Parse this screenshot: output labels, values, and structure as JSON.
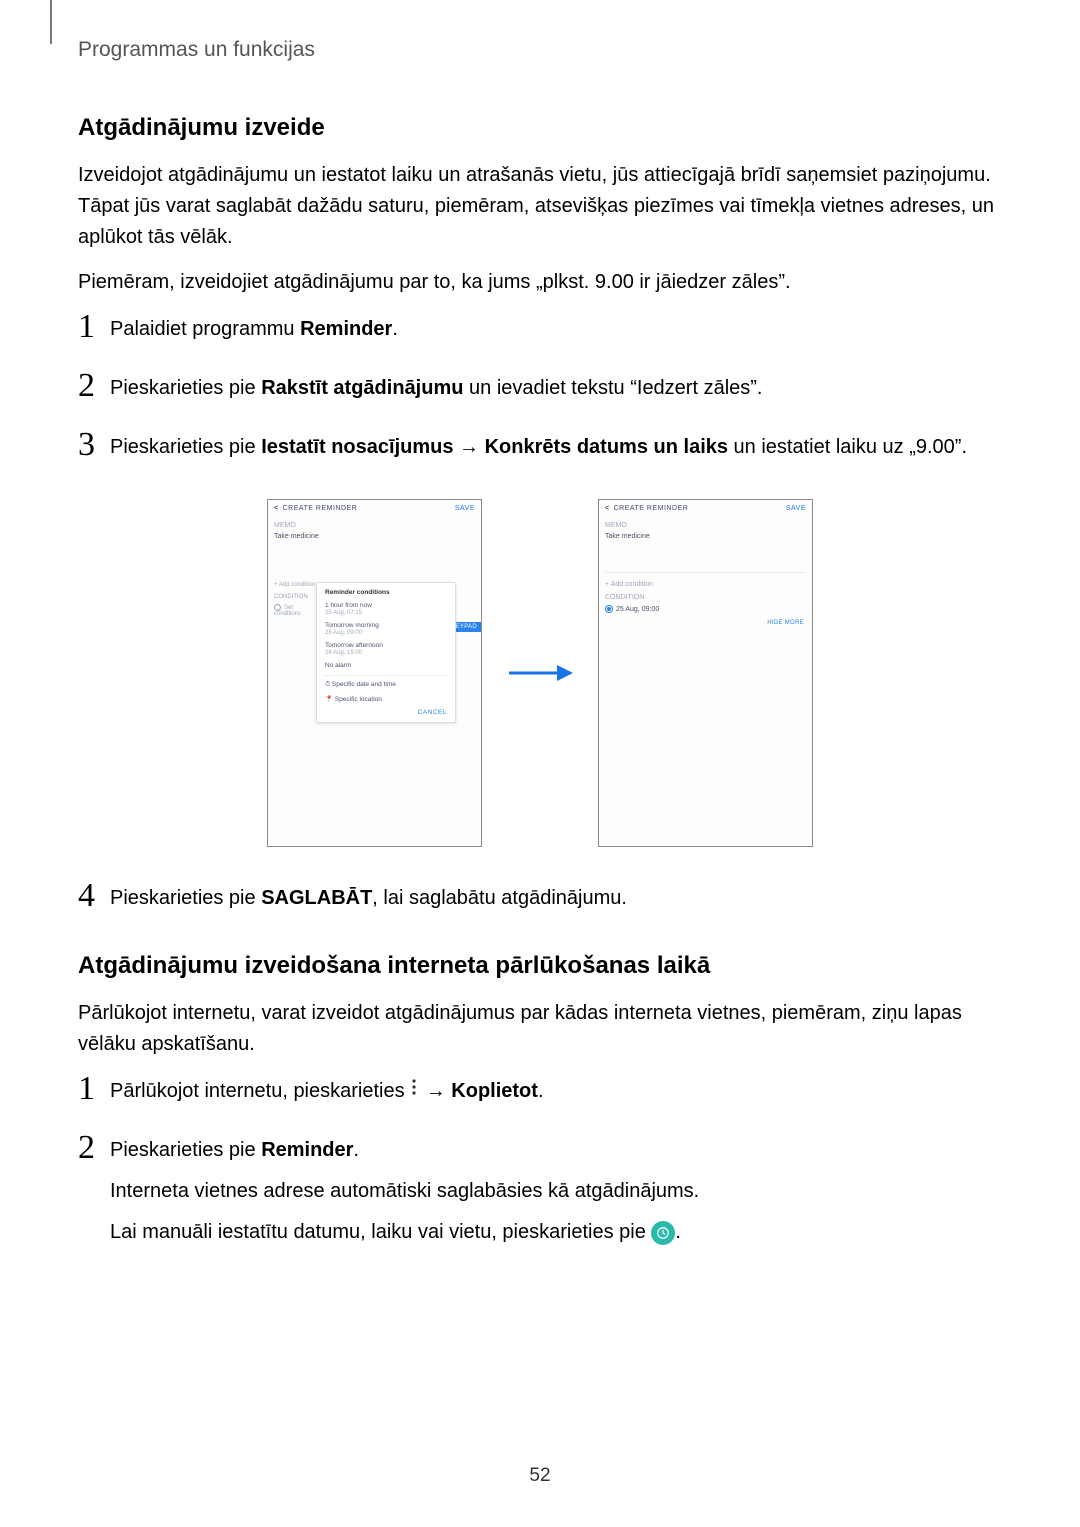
{
  "page": {
    "header": "Programmas un funkcijas",
    "number": "52"
  },
  "section1": {
    "title": "Atgādinājumu izveide",
    "p1": "Izveidojot atgādinājumu un iestatot laiku un atrašanās vietu, jūs attiecīgajā brīdī saņemsiet paziņojumu. Tāpat jūs varat saglabāt dažādu saturu, piemēram, atsevišķas piezīmes vai tīmekļa vietnes adreses, un aplūkot tās vēlāk.",
    "p2": "Piemēram, izveidojiet atgādinājumu par to, ka jums „plkst. 9.00 ir jāiedzer zāles”.",
    "step1_a": "Palaidiet programmu ",
    "step1_b": "Reminder",
    "step1_c": ".",
    "step2_a": "Pieskarieties pie ",
    "step2_b": "Rakstīt atgādinājumu",
    "step2_c": " un ievadiet tekstu “Iedzert zāles”.",
    "step3_a": "Pieskarieties pie ",
    "step3_b": "Iestatīt nosacījumus",
    "step3_c": " → ",
    "step3_d": "Konkrēts datums un laiks",
    "step3_e": " un iestatiet laiku uz „9.00”.",
    "step4_a": "Pieskarieties pie ",
    "step4_b": "SAGLABĀT",
    "step4_c": ", lai saglabātu atgādinājumu."
  },
  "mockLeft": {
    "title": "CREATE REMINDER",
    "save": "SAVE",
    "memoLabel": "MEMO",
    "memoText": "Take medicine",
    "sideAdd": "+ Add condition",
    "sideCond": "CONDITION",
    "sideSetCond": "Set conditions",
    "keyLabel": "HIDE KEYPAD",
    "popupTitle": "Reminder conditions",
    "popOpt1": "1 hour from now",
    "popOpt1Sub": "25 Aug, 07:15",
    "popOpt2": "Tomorrow morning",
    "popOpt2Sub": "26 Aug, 09:00",
    "popOpt3": "Tomorrow afternoon",
    "popOpt3Sub": "26 Aug, 15:00",
    "popOpt4": "No alarm",
    "popOpt5": "Specific date and time",
    "popOpt6": "Specific location",
    "popCancel": "CANCEL"
  },
  "mockRight": {
    "title": "CREATE REMINDER",
    "save": "SAVE",
    "memoLabel": "MEMO",
    "memoText": "Take medicine",
    "addCond": "+ Add condition",
    "condLabel": "CONDITION",
    "setDate": "25 Aug, 09:00",
    "more": "HIDE MORE"
  },
  "section2": {
    "title": "Atgādinājumu izveidošana interneta pārlūkošanas laikā",
    "p1": "Pārlūkojot internetu, varat izveidot atgādinājumus par kādas interneta vietnes, piemēram, ziņu lapas vēlāku apskatīšanu.",
    "step1_a": "Pārlūkojot internetu, pieskarieties ",
    "step1_b": " → ",
    "step1_c": "Koplietot",
    "step1_d": ".",
    "step2_a": "Pieskarieties pie ",
    "step2_b": "Reminder",
    "step2_c": ".",
    "step2_p2": "Interneta vietnes adrese automātiski saglabāsies kā atgādinājums.",
    "step2_p3_a": "Lai manuāli iestatītu datumu, laiku vai vietu, pieskarieties pie ",
    "step2_p3_b": "."
  }
}
